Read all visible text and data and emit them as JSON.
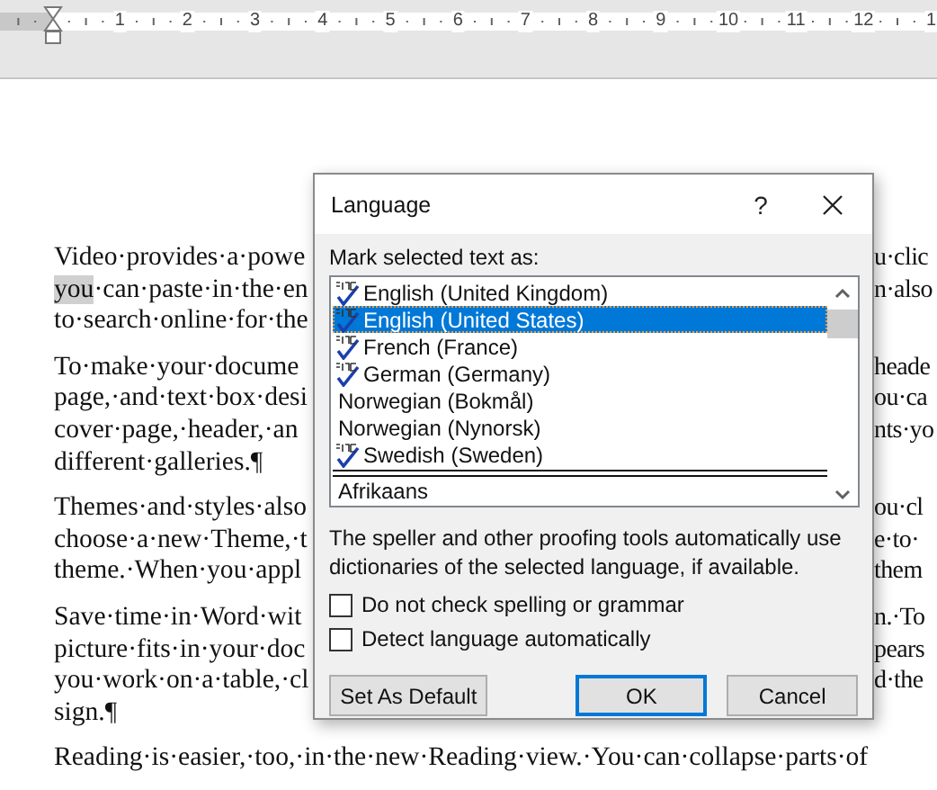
{
  "ruler": {
    "numbers": [
      "1",
      "2",
      "3",
      "4",
      "5",
      "6",
      "7",
      "8",
      "9",
      "10",
      "11",
      "12",
      "1"
    ]
  },
  "document": {
    "paragraphs": [
      {
        "lines": [
          {
            "left": [
              {
                "text": "Video·provides·a·powe",
                "selected": false
              }
            ],
            "right": "u·clic"
          },
          {
            "left": [
              {
                "text": "you",
                "selected": true
              },
              {
                "text": "·can·paste·in·the·en",
                "selected": false
              }
            ],
            "right": "n·also"
          },
          {
            "left": [
              {
                "text": "to·search·online·for·the",
                "selected": false
              }
            ]
          }
        ]
      },
      {
        "lines": [
          {
            "left": [
              {
                "text": "To·make·your·docume",
                "selected": false
              }
            ],
            "right": "heade"
          },
          {
            "left": [
              {
                "text": "page,·and·text·box·desi",
                "selected": false
              }
            ],
            "right": "ou·ca"
          },
          {
            "left": [
              {
                "text": "cover·page,·header,·an",
                "selected": false
              }
            ],
            "right": "nts·yo"
          },
          {
            "left": [
              {
                "text": "different·galleries.¶",
                "selected": false
              }
            ]
          }
        ]
      },
      {
        "lines": [
          {
            "left": [
              {
                "text": "Themes·and·styles·also",
                "selected": false
              }
            ],
            "right": "ou·cl"
          },
          {
            "left": [
              {
                "text": "choose·a·new·Theme,·t",
                "selected": false
              }
            ],
            "right": "e·to·"
          },
          {
            "left": [
              {
                "text": "theme.·When·you·appl",
                "selected": false
              }
            ],
            "right": "them"
          }
        ]
      },
      {
        "lines": [
          {
            "left": [
              {
                "text": "Save·time·in·Word·wit",
                "selected": false
              }
            ],
            "right": "n.·To"
          },
          {
            "left": [
              {
                "text": "picture·fits·in·your·doc",
                "selected": false
              }
            ],
            "right": "pears"
          },
          {
            "left": [
              {
                "text": "you·work·on·a·table,·cl",
                "selected": false
              }
            ],
            "right": "d·the"
          },
          {
            "left": [
              {
                "text": "sign.¶",
                "selected": false
              }
            ]
          }
        ]
      },
      {
        "lines": [
          {
            "left": [
              {
                "text": "Reading·is·easier,·too,·in·the·new·Reading·view.·You·can·collapse·parts·of",
                "selected": false
              }
            ]
          }
        ]
      }
    ]
  },
  "dialog": {
    "title": "Language",
    "help": "?",
    "list_label": "Mark selected text as:",
    "recent_languages": [
      {
        "name": "English (United Kingdom)",
        "proofing": true,
        "selected": false
      },
      {
        "name": "English (United States)",
        "proofing": true,
        "selected": true
      },
      {
        "name": "French (France)",
        "proofing": true,
        "selected": false
      },
      {
        "name": "German (Germany)",
        "proofing": true,
        "selected": false
      },
      {
        "name": "Norwegian (Bokmål)",
        "proofing": false,
        "selected": false
      },
      {
        "name": "Norwegian (Nynorsk)",
        "proofing": false,
        "selected": false
      },
      {
        "name": "Swedish (Sweden)",
        "proofing": true,
        "selected": false
      }
    ],
    "other_languages": [
      {
        "name": "Afrikaans",
        "proofing": false,
        "selected": false
      }
    ],
    "note": "The speller and other proofing tools automatically use dictionaries of the selected language, if available.",
    "checkboxes": [
      {
        "label": "Do not check spelling or grammar",
        "checked": false
      },
      {
        "label": "Detect language automatically",
        "checked": false
      }
    ],
    "buttons": [
      {
        "label": "Set As Default",
        "default": false
      },
      {
        "label": "OK",
        "default": true
      },
      {
        "label": "Cancel",
        "default": false
      }
    ]
  }
}
